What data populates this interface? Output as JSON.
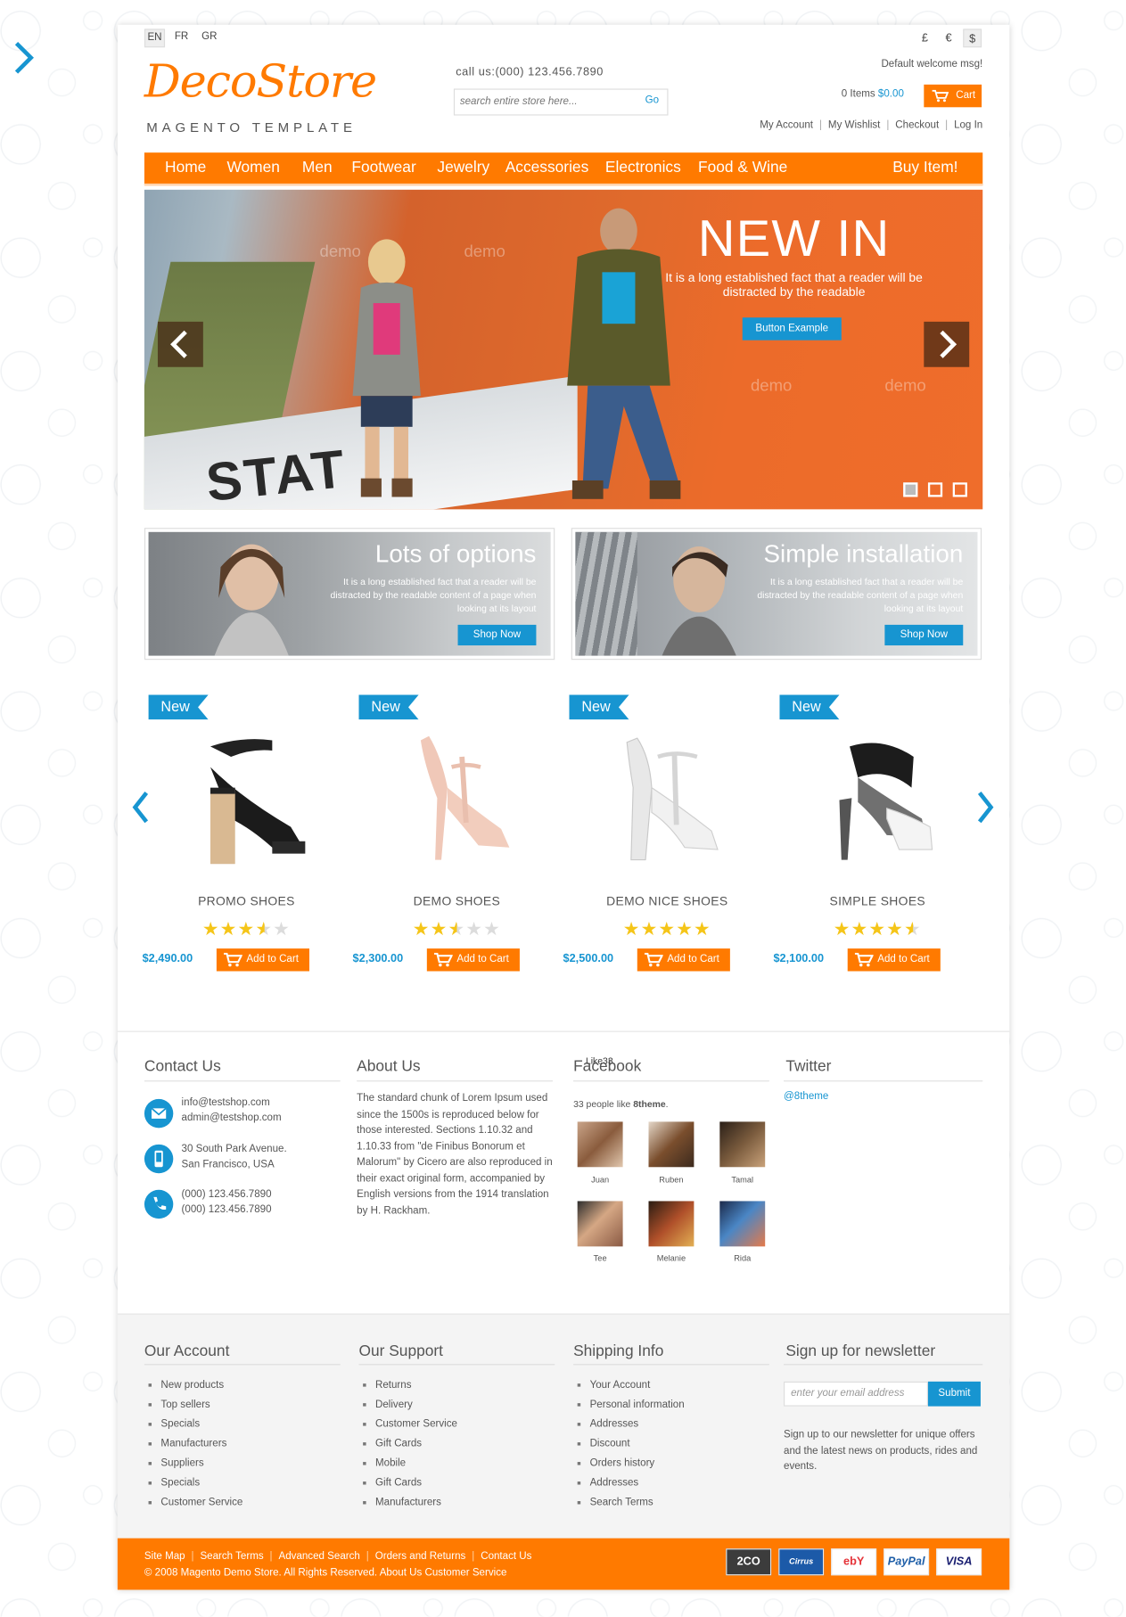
{
  "languages": [
    "EN",
    "FR",
    "GR"
  ],
  "currencies": [
    "£",
    "€",
    "$"
  ],
  "header": {
    "logo_main": "DecoStore",
    "logo_sub": "MAGENTO TEMPLATE",
    "call": "call us:(000) 123.456.7890",
    "search_placeholder": "search entire store here...",
    "search_go": "Go",
    "welcome": "Default welcome msg!",
    "cart_items": "0 Items",
    "cart_total": "$0.00",
    "cart_button": "Cart",
    "top_links": [
      "My Account",
      "My Wishlist",
      "Checkout",
      "Log In"
    ]
  },
  "nav": {
    "items": [
      "Home",
      "Women",
      "Men",
      "Footwear",
      "Jewelry",
      "Accessories",
      "Electronics",
      "Food & Wine"
    ],
    "right": "Buy Item!"
  },
  "hero": {
    "title": "NEW IN",
    "desc": "It is a long established fact that a reader will be distracted by the readable",
    "button": "Button Example",
    "plane_text": "STAT",
    "watermark": "demo",
    "slides": 3,
    "active_slide": 1
  },
  "promos": [
    {
      "title": "Lots of options",
      "desc": "It is a long established fact that a reader will be distracted by the readable content of a page when looking at its layout",
      "button": "Shop Now"
    },
    {
      "title": "Simple installation",
      "desc": "It is a long established fact that a reader will be distracted by the readable content of a page when looking at its layout",
      "button": "Shop Now"
    }
  ],
  "products": [
    {
      "badge": "New",
      "name": "PROMO SHOES",
      "rating": 3.5,
      "price": "$2,490.00",
      "button": "Add to Cart"
    },
    {
      "badge": "New",
      "name": "DEMO SHOES",
      "rating": 2.5,
      "price": "$2,300.00",
      "button": "Add to Cart"
    },
    {
      "badge": "New",
      "name": "DEMO NICE SHOES",
      "rating": 5,
      "price": "$2,500.00",
      "button": "Add to Cart"
    },
    {
      "badge": "New",
      "name": "SIMPLE SHOES",
      "rating": 4.5,
      "price": "$2,100.00",
      "button": "Add to Cart"
    }
  ],
  "info": {
    "contact_title": "Contact Us",
    "emails": [
      "info@testshop.com",
      "admin@testshop.com"
    ],
    "address": [
      "30 South Park Avenue.",
      "San Francisco, USA"
    ],
    "phones": [
      "(000) 123.456.7890",
      "(000) 123.456.7890"
    ],
    "about_title": "About Us",
    "about_text": "The standard chunk of Lorem Ipsum used since the 1500s is reproduced below for those interested. Sections 1.10.32 and 1.10.33 from \"de Finibus Bonorum et Malorum\" by Cicero are also reproduced in their exact original form, accompanied by English versions from the 1914 translation by H. Rackham.",
    "facebook_title": "Facebook",
    "facebook_overlay": "Like33",
    "facebook_count": "33 people like",
    "facebook_page": "8theme",
    "facebook_people": [
      "Juan",
      "Ruben",
      "Tamal",
      "Tee",
      "Melanie",
      "Rida"
    ],
    "twitter_title": "Twitter",
    "twitter_handle": "@8theme"
  },
  "footer": {
    "account_title": "Our Account",
    "account_links": [
      "New products",
      "Top sellers",
      "Specials",
      "Manufacturers",
      "Suppliers",
      "Specials",
      "Customer Service"
    ],
    "support_title": "Our Support",
    "support_links": [
      "Returns",
      "Delivery",
      "Customer Service",
      "Gift Cards",
      "Mobile",
      "Gift Cards",
      "Manufacturers"
    ],
    "shipping_title": "Shipping Info",
    "shipping_links": [
      "Your Account",
      "Personal information",
      "Addresses",
      "Discount",
      "Orders history",
      "Addresses",
      "Search Terms"
    ],
    "newsletter_title": "Sign up for newsletter",
    "newsletter_placeholder": "enter your email address",
    "newsletter_button": "Submit",
    "newsletter_text": "Sign up to our newsletter for unique offers and the latest news on products, rides and events.",
    "bottom_links": [
      "Site Map",
      "Search Terms",
      "Advanced Search",
      "Orders and Returns",
      "Contact Us"
    ],
    "copyright": "© 2008 Magento Demo Store. All Rights Reserved.",
    "copyright_links": [
      "About Us",
      "Customer Service"
    ],
    "payments": [
      "2CO",
      "Cirrus",
      "ebY",
      "PayPal",
      "VISA"
    ]
  },
  "colors": {
    "accent": "#ff7a00",
    "link": "#1795d1",
    "star": "#f5c518"
  }
}
